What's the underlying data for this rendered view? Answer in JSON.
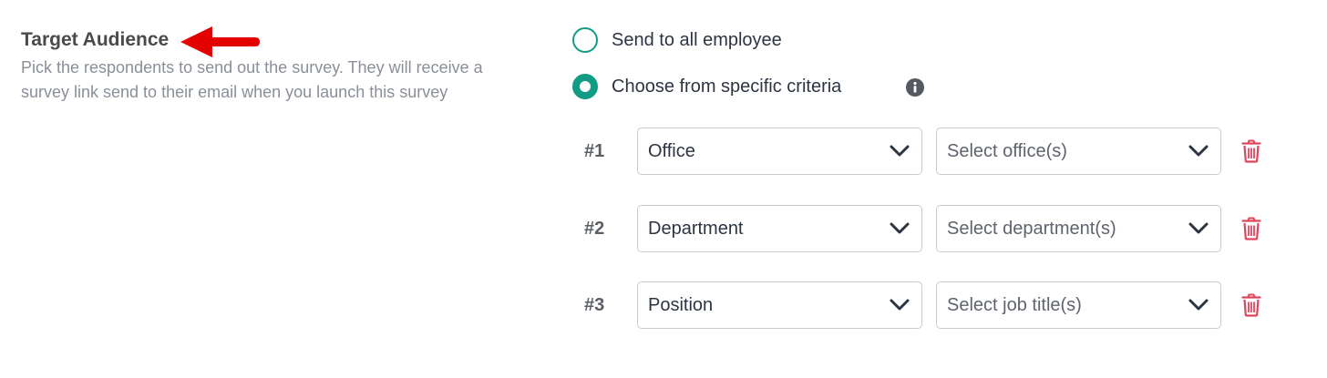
{
  "section": {
    "title": "Target Audience",
    "description": "Pick the respondents to send out the survey. They will receive a survey link send to their email when you launch this survey"
  },
  "radios": [
    {
      "label": "Send to all employee",
      "checked": false
    },
    {
      "label": "Choose from specific criteria",
      "checked": true
    }
  ],
  "criteria": [
    {
      "number": "#1",
      "field": "Office",
      "placeholder": "Select office(s)"
    },
    {
      "number": "#2",
      "field": "Department",
      "placeholder": "Select department(s)"
    },
    {
      "number": "#3",
      "field": "Position",
      "placeholder": "Select job title(s)"
    }
  ],
  "icons": {
    "annotation": "red-arrow-icon",
    "info": "info-icon",
    "dropdown": "chevron-down-icon",
    "delete": "trash-icon"
  },
  "colors": {
    "accent": "#129c86",
    "danger": "#e0455e",
    "arrow": "#e50000"
  }
}
